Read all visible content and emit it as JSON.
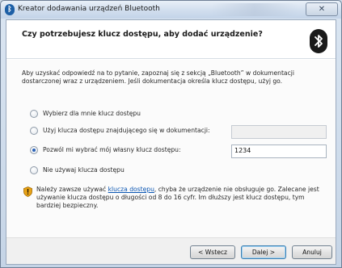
{
  "window": {
    "title": "Kreator dodawania urządzeń Bluetooth",
    "close_label": "✕"
  },
  "header": {
    "question": "Czy potrzebujesz klucz dostępu, aby dodać urządzenie?"
  },
  "description": "Aby uzyskać odpowiedź na to pytanie, zapoznaj się z sekcją „Bluetooth” w dokumentacji dostarczonej wraz z urządzeniem. Jeśli dokumentacja określa klucz dostępu, użyj go.",
  "options": [
    {
      "label": "Wybierz dla mnie klucz dostępu",
      "checked": false
    },
    {
      "label": "Użyj klucza dostępu znajdującego się w dokumentacji:",
      "checked": false,
      "field_value": ""
    },
    {
      "label": "Pozwól mi wybrać mój własny klucz dostępu:",
      "checked": true,
      "field_value": "1234"
    },
    {
      "label": "Nie używaj klucza dostępu",
      "checked": false
    }
  ],
  "warning": {
    "prefix": "Należy zawsze używać ",
    "link": "klucza dostępu",
    "suffix": ", chyba że urządzenie nie obsługuje go. Zalecane jest używanie klucza dostępu o długości od 8 do 16 cyfr. Im dłuższy jest klucz dostępu, tym bardziej bezpieczny."
  },
  "buttons": {
    "back": "< Wstecz",
    "next": "Dalej >",
    "cancel": "Anuluj"
  },
  "colors": {
    "accent": "#2a62b8",
    "link": "#0b56b3"
  }
}
